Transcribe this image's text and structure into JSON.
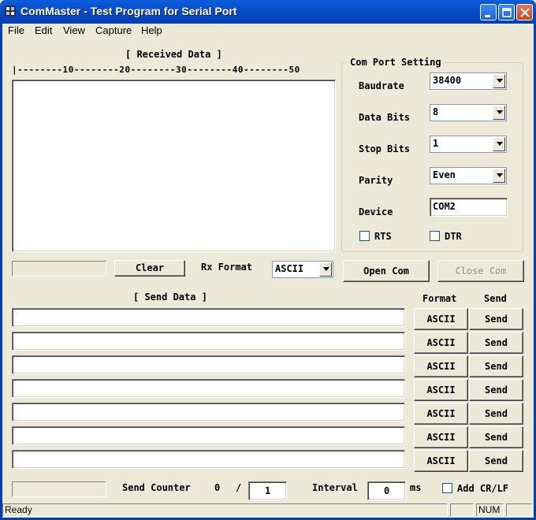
{
  "window": {
    "title": "ComMaster - Test Program for Serial Port"
  },
  "menu": [
    "File",
    "Edit",
    "View",
    "Capture",
    "Help"
  ],
  "received": {
    "label": "[ Received Data ]",
    "ruler": "|--------10--------20--------30--------40--------50",
    "clear_button": "Clear",
    "rx_format_label": "Rx Format",
    "rx_format_value": "ASCII"
  },
  "com_port": {
    "group_label": "Com Port Setting",
    "baudrate_label": "Baudrate",
    "baudrate_value": "38400",
    "databits_label": "Data Bits",
    "databits_value": "8",
    "stopbits_label": "Stop Bits",
    "stopbits_value": "1",
    "parity_label": "Parity",
    "parity_value": "Even",
    "device_label": "Device",
    "device_value": "COM2",
    "rts_label": "RTS",
    "dtr_label": "DTR",
    "open_button": "Open Com",
    "close_button": "Close Com"
  },
  "send": {
    "label": "[ Send Data ]",
    "format_header": "Format",
    "send_header": "Send",
    "rows": [
      {
        "format": "ASCII",
        "send": "Send",
        "value": ""
      },
      {
        "format": "ASCII",
        "send": "Send",
        "value": ""
      },
      {
        "format": "ASCII",
        "send": "Send",
        "value": ""
      },
      {
        "format": "ASCII",
        "send": "Send",
        "value": ""
      },
      {
        "format": "ASCII",
        "send": "Send",
        "value": ""
      },
      {
        "format": "ASCII",
        "send": "Send",
        "value": ""
      },
      {
        "format": "ASCII",
        "send": "Send",
        "value": ""
      }
    ]
  },
  "footer": {
    "send_counter_label": "Send Counter",
    "send_counter_value": "0",
    "separator": "/",
    "send_counter_total": "1",
    "interval_label": "Interval",
    "interval_value": "0",
    "interval_unit": "ms",
    "add_crlf_label": "Add CR/LF"
  },
  "status": {
    "text": "Ready",
    "num": "NUM"
  }
}
